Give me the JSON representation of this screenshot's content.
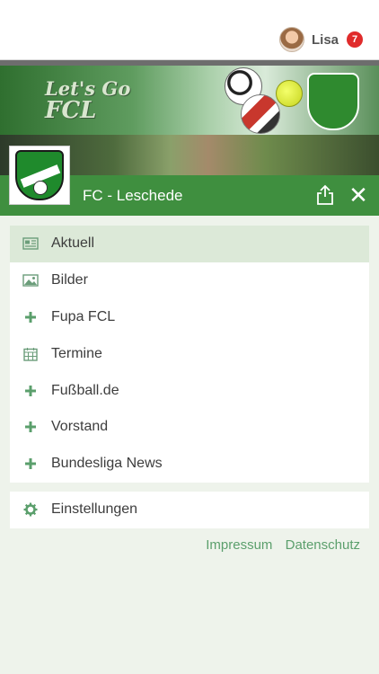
{
  "user": {
    "name": "Lisa",
    "notifications": "7"
  },
  "banner": {
    "slogan_line1": "Let's Go",
    "slogan_line2": "FCL"
  },
  "logo": {
    "founded": "FC 1947",
    "band": "LESCHEDE e.V."
  },
  "header": {
    "club_name": "FC - Leschede",
    "close_label": "✕"
  },
  "menu": {
    "items": [
      {
        "label": "Aktuell",
        "icon": "newspaper-icon",
        "active": true
      },
      {
        "label": "Bilder",
        "icon": "image-icon"
      },
      {
        "label": "Fupa FCL",
        "icon": "plus-icon"
      },
      {
        "label": "Termine",
        "icon": "calendar-icon"
      },
      {
        "label": "Fußball.de",
        "icon": "plus-icon"
      },
      {
        "label": "Vorstand",
        "icon": "plus-icon"
      },
      {
        "label": "Bundesliga News",
        "icon": "plus-icon"
      }
    ],
    "settings": {
      "label": "Einstellungen",
      "icon": "gear-icon"
    }
  },
  "footer": {
    "impressum": "Impressum",
    "datenschutz": "Datenschutz"
  },
  "colors": {
    "accent": "#3f8f3f",
    "link": "#5b9f6c",
    "active_row": "#dce9d8",
    "badge": "#e02b2b"
  }
}
